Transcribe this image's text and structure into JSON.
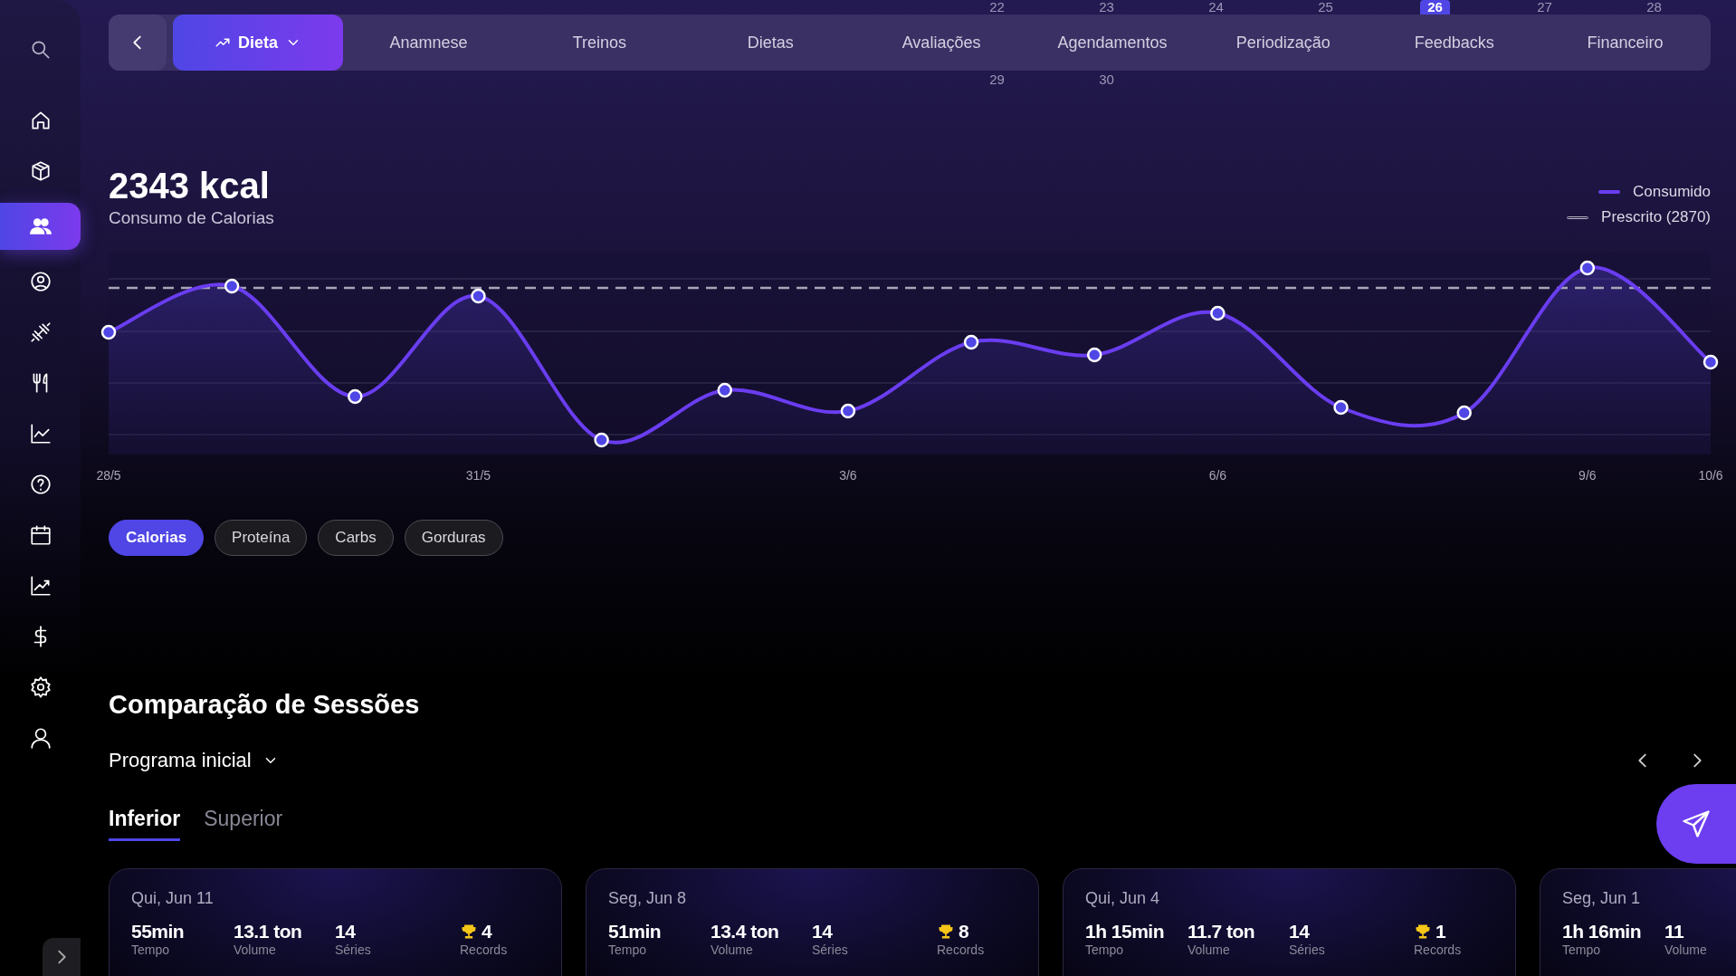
{
  "sidebar": {
    "items": [
      {
        "selected": false
      },
      {
        "selected": false
      },
      {
        "selected": false
      },
      {
        "selected": true
      },
      {
        "selected": false
      },
      {
        "selected": false
      },
      {
        "selected": false
      },
      {
        "selected": false
      },
      {
        "selected": false
      },
      {
        "selected": false
      },
      {
        "selected": false
      },
      {
        "selected": false
      },
      {
        "selected": false
      },
      {
        "selected": false
      }
    ]
  },
  "calendar_strip": {
    "days": [
      {
        "label": "22",
        "selected": false
      },
      {
        "label": "23",
        "selected": false
      },
      {
        "label": "24",
        "selected": false
      },
      {
        "label": "25",
        "selected": false
      },
      {
        "label": "26",
        "selected": true
      },
      {
        "label": "27",
        "selected": false
      },
      {
        "label": "28",
        "selected": false
      }
    ],
    "next_row": [
      "29",
      "30"
    ]
  },
  "nav": {
    "tabs": [
      {
        "label": "Dieta",
        "selected": true
      },
      {
        "label": "Anamnese",
        "selected": false
      },
      {
        "label": "Treinos",
        "selected": false
      },
      {
        "label": "Dietas",
        "selected": false
      },
      {
        "label": "Avaliações",
        "selected": false
      },
      {
        "label": "Agendamentos",
        "selected": false
      },
      {
        "label": "Periodização",
        "selected": false
      },
      {
        "label": "Feedbacks",
        "selected": false
      },
      {
        "label": "Financeiro",
        "selected": false
      }
    ]
  },
  "calories": {
    "value": "2343 kcal",
    "label": "Consumo de Calorias",
    "legend": [
      {
        "label": "Consumido",
        "kind": "solid"
      },
      {
        "label": "Prescrito (2870)",
        "kind": "dashed"
      }
    ],
    "x_labels": [
      "28/5",
      "31/5",
      "3/6",
      "6/6",
      "9/6",
      "10/6"
    ]
  },
  "filters": [
    {
      "label": "Calorias",
      "selected": true
    },
    {
      "label": "Proteína",
      "selected": false
    },
    {
      "label": "Carbs",
      "selected": false
    },
    {
      "label": "Gorduras",
      "selected": false
    }
  ],
  "sessions": {
    "title": "Comparação de Sessões",
    "program": "Programa inicial",
    "tabs": [
      {
        "label": "Inferior",
        "selected": true
      },
      {
        "label": "Superior",
        "selected": false
      }
    ],
    "cards": [
      {
        "date": "Qui, Jun 11",
        "stats": [
          {
            "kind": "plain",
            "value": "55min",
            "label": "Tempo"
          },
          {
            "kind": "plain",
            "value": "13.1 ton",
            "label": "Volume"
          },
          {
            "kind": "plain",
            "value": "14",
            "label": "Séries"
          },
          {
            "kind": "records",
            "value": "4",
            "label": "Records"
          }
        ]
      },
      {
        "date": "Seg, Jun 8",
        "stats": [
          {
            "kind": "plain",
            "value": "51min",
            "label": "Tempo"
          },
          {
            "kind": "plain",
            "value": "13.4 ton",
            "label": "Volume"
          },
          {
            "kind": "plain",
            "value": "14",
            "label": "Séries"
          },
          {
            "kind": "records",
            "value": "8",
            "label": "Records"
          }
        ]
      },
      {
        "date": "Qui, Jun 4",
        "stats": [
          {
            "kind": "plain",
            "value": "1h 15min",
            "label": "Tempo"
          },
          {
            "kind": "plain",
            "value": "11.7 ton",
            "label": "Volume"
          },
          {
            "kind": "plain",
            "value": "14",
            "label": "Séries"
          },
          {
            "kind": "records",
            "value": "1",
            "label": "Records"
          }
        ]
      },
      {
        "date": "Seg, Jun 1",
        "stats": [
          {
            "kind": "plain",
            "value": "1h 16min",
            "label": "Tempo"
          },
          {
            "kind": "plain",
            "value": "11",
            "label": "Volume"
          }
        ]
      }
    ]
  }
}
